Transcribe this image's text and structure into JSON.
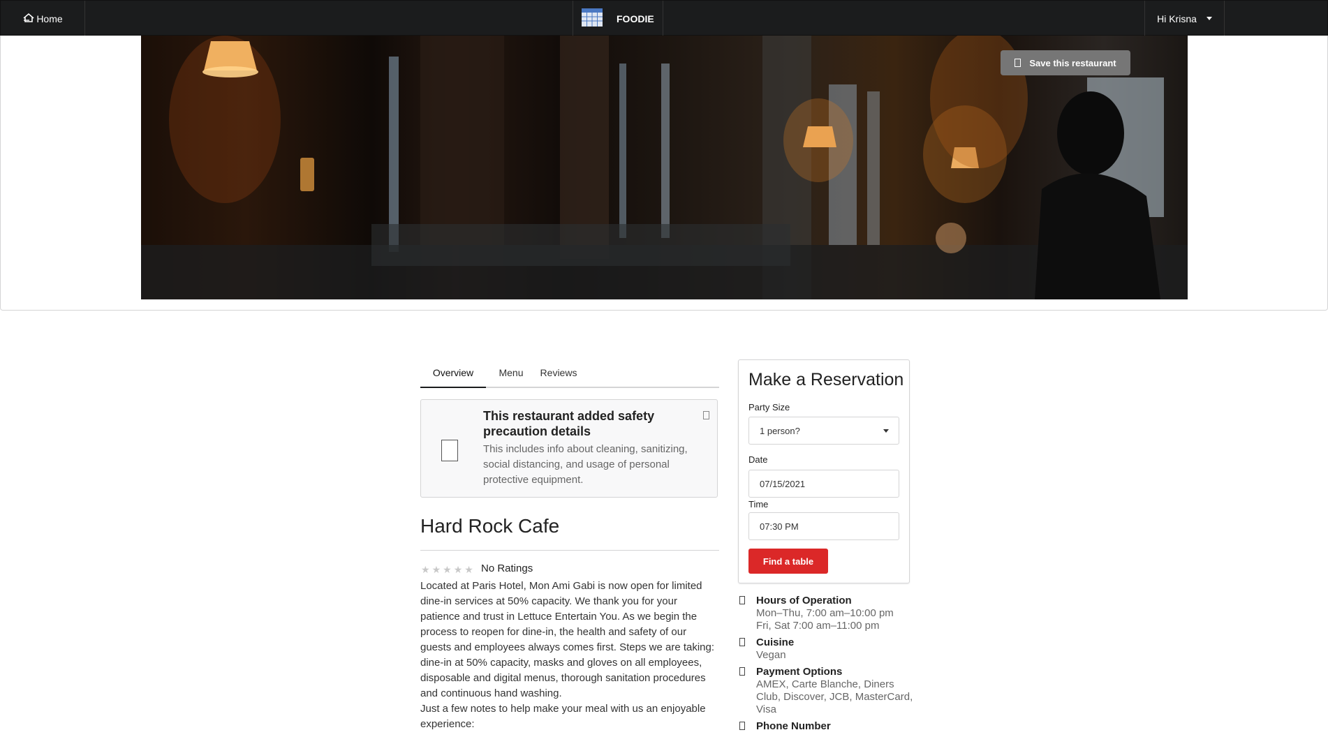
{
  "nav": {
    "home_label": "Home",
    "brand": "FOODIE",
    "user_greeting": "Hi Krisna"
  },
  "hero": {
    "save_label": "Save this restaurant"
  },
  "tabs": [
    {
      "label": "Overview"
    },
    {
      "label": "Menu"
    },
    {
      "label": "Reviews"
    }
  ],
  "safety": {
    "heading": "This restaurant added safety precaution details",
    "body": "This includes info about cleaning, sanitizing, social distancing, and usage of personal protective equipment."
  },
  "restaurant": {
    "name": "Hard Rock Cafe",
    "rating_text": "No Ratings",
    "stars": 0,
    "description_1": "Located at Paris Hotel, Mon Ami Gabi is now open for limited dine-in services at 50% capacity. We thank you for your patience and trust in Lettuce Entertain You. As we begin the process to reopen for dine-in, the health and safety of our guests and employees always comes first. Steps we are taking: dine-in at 50% capacity, masks and gloves on all employees, disposable and digital menus, thorough sanitation procedures and continuous hand washing.",
    "description_2": "Just a few notes to help make your meal with us an enjoyable experience:"
  },
  "reservation": {
    "title": "Make a Reservation",
    "party_label": "Party Size",
    "party_value": "1 person?",
    "date_label": "Date",
    "date_value": "07/15/2021",
    "time_label": "Time",
    "time_value": "07:30 PM",
    "submit_label": "Find a table"
  },
  "details": {
    "hours_title": "Hours of Operation",
    "hours_line1": "Mon–Thu, 7:00 am–10:00 pm",
    "hours_line2": "Fri, Sat 7:00 am–11:00 pm",
    "cuisine_title": "Cuisine",
    "cuisine_value": "Vegan",
    "payment_title": "Payment Options",
    "payment_value": "AMEX, Carte Blanche, Diners Club, Discover, JCB, MasterCard, Visa",
    "phone_title": "Phone Number"
  },
  "colors": {
    "navbar": "#1b1c1d",
    "primary_button": "#db2828",
    "save_button": "#767676"
  }
}
